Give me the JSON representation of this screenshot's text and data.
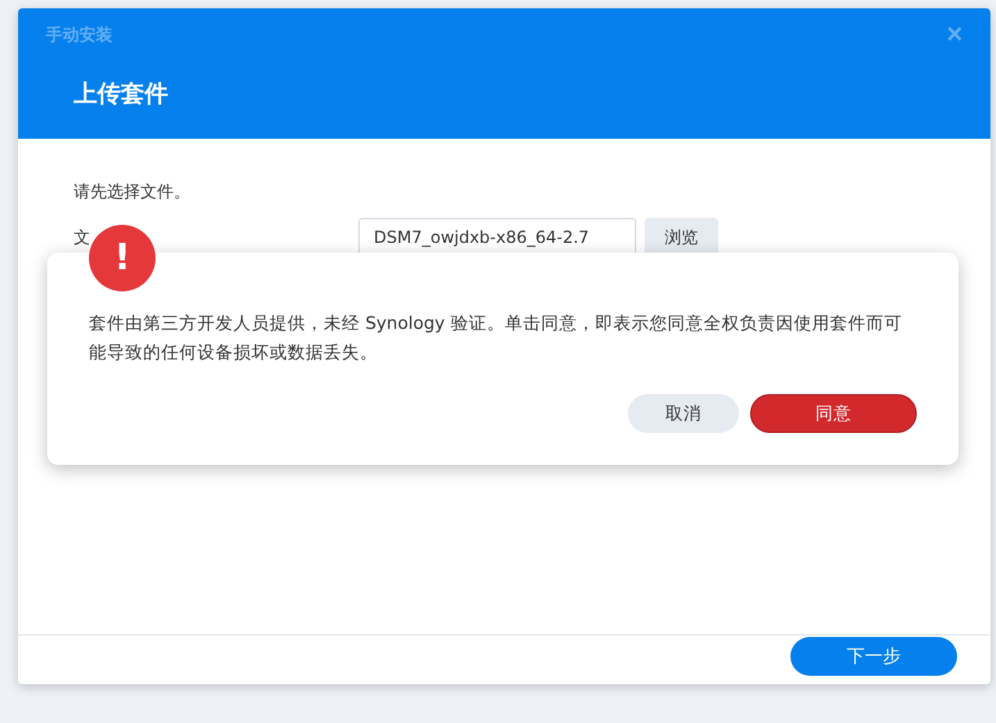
{
  "window": {
    "title": "手动安装",
    "close": "×"
  },
  "header": {
    "heading": "上传套件"
  },
  "body": {
    "instruction": "请先选择文件。",
    "file_label": "文",
    "file_value": "DSM7_owjdxb-x86_64-2.7",
    "browse_button": "浏览"
  },
  "alert": {
    "icon": "!",
    "message": "套件由第三方开发人员提供，未经 Synology 验证。单击同意，即表示您同意全权负责因使用套件而可能导致的任何设备损坏或数据丢失。",
    "buttons": [
      {
        "label": "取消",
        "kind": "secondary"
      },
      {
        "label": "同意",
        "kind": "danger"
      }
    ]
  },
  "footer": {
    "next_button": "下一步"
  }
}
